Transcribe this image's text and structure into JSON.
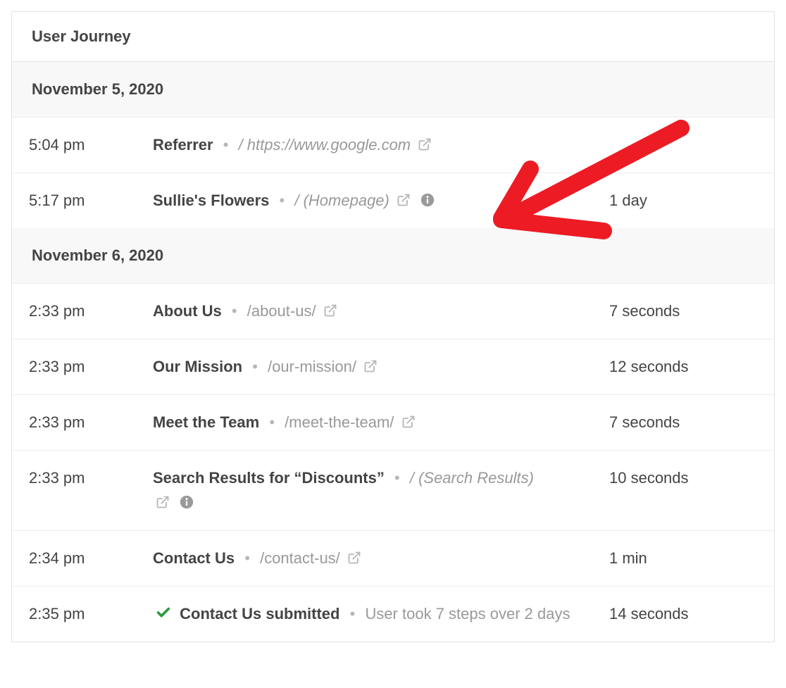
{
  "panel": {
    "title": "User Journey"
  },
  "groups": [
    {
      "date": "November 5, 2020",
      "rows": [
        {
          "time": "5:04 pm",
          "title": "Referrer",
          "path_prefix": "/ ",
          "path": "https://www.google.com",
          "path_italic": true,
          "external": true,
          "info": false,
          "duration": ""
        },
        {
          "time": "5:17 pm",
          "title": "Sullie's Flowers",
          "path_prefix": "/ ",
          "path": "(Homepage)",
          "path_italic": true,
          "external": true,
          "info": true,
          "duration": "1 day"
        }
      ]
    },
    {
      "date": "November 6, 2020",
      "rows": [
        {
          "time": "2:33 pm",
          "title": "About Us",
          "path_prefix": "",
          "path": "/about-us/",
          "path_italic": false,
          "external": true,
          "info": false,
          "duration": "7 seconds"
        },
        {
          "time": "2:33 pm",
          "title": "Our Mission",
          "path_prefix": "",
          "path": "/our-mission/",
          "path_italic": false,
          "external": true,
          "info": false,
          "duration": "12 seconds"
        },
        {
          "time": "2:33 pm",
          "title": "Meet the Team",
          "path_prefix": "",
          "path": "/meet-the-team/",
          "path_italic": false,
          "external": true,
          "info": false,
          "duration": "7 seconds"
        },
        {
          "time": "2:33 pm",
          "title": "Search Results for “Discounts”",
          "path_prefix": "/ ",
          "path": "(Search Results)",
          "path_italic": true,
          "external": true,
          "info": true,
          "wrap_icons": true,
          "duration": "10 seconds"
        },
        {
          "time": "2:34 pm",
          "title": "Contact Us",
          "path_prefix": "",
          "path": "/contact-us/",
          "path_italic": false,
          "external": true,
          "info": false,
          "duration": "1 min"
        },
        {
          "time": "2:35 pm",
          "submitted": true,
          "title": "Contact Us submitted",
          "summary": "User took 7 steps over 2 days",
          "duration": "14 seconds"
        }
      ]
    }
  ]
}
